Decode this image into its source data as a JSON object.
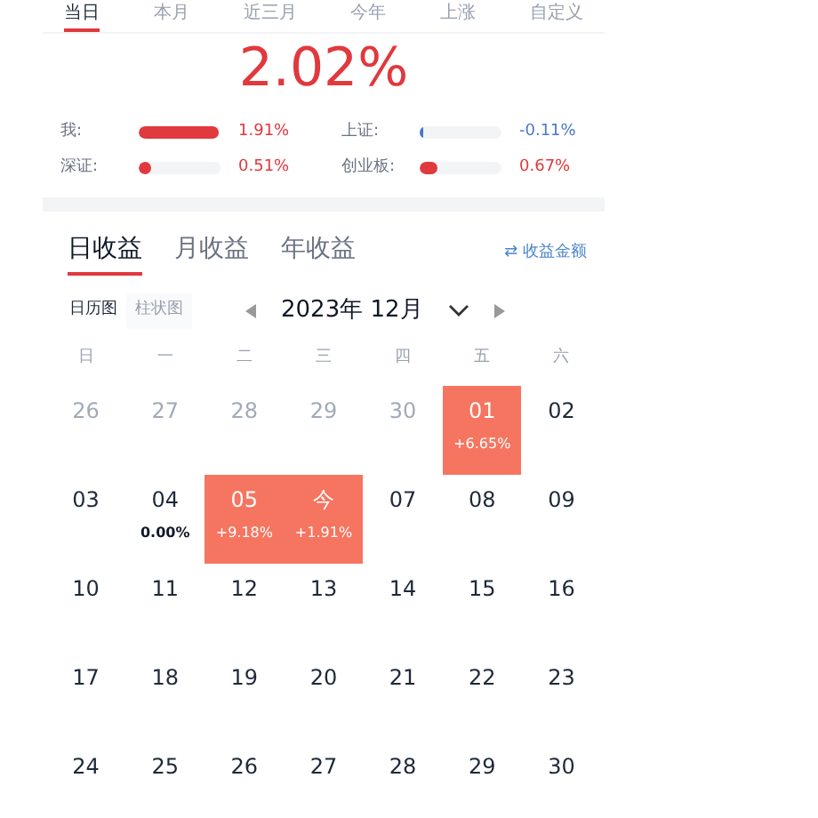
{
  "period_tabs": [
    {
      "label": "当日",
      "selected": true
    },
    {
      "label": "本月",
      "selected": false
    },
    {
      "label": "近三月",
      "selected": false
    },
    {
      "label": "今年",
      "selected": false
    },
    {
      "label": "上涨",
      "selected": false
    },
    {
      "label": "自定义",
      "selected": false
    }
  ],
  "total_return": "2.02%",
  "stats": [
    {
      "label": "我:",
      "level": 0.97,
      "color": "#e0393e",
      "value": "1.91%"
    },
    {
      "label": "上证:",
      "level": 0.02,
      "color": "#4a78c8",
      "value": "-0.11%"
    },
    {
      "label": "深证:",
      "level": 0.15,
      "color": "#e0393e",
      "value": "0.51%"
    },
    {
      "label": "创业板:",
      "level": 0.22,
      "color": "#e0393e",
      "value": "0.67%"
    }
  ],
  "return_tabs": [
    {
      "label": "日收益",
      "selected": true
    },
    {
      "label": "月收益",
      "selected": false
    },
    {
      "label": "年收益",
      "selected": false
    }
  ],
  "toggle_link": "⇄ 收益金额",
  "view_tabs": [
    {
      "label": "日历图",
      "selected": true
    },
    {
      "label": "柱状图",
      "selected": false
    }
  ],
  "month": "2023年 12月",
  "weekdays": [
    "日",
    "一",
    "二",
    "三",
    "四",
    "五",
    "六"
  ],
  "weeks": [
    [
      {
        "day": "26",
        "muted": true,
        "highlighted": false
      },
      {
        "day": "27",
        "muted": true,
        "highlighted": false
      },
      {
        "day": "28",
        "muted": true,
        "highlighted": false
      },
      {
        "day": "29",
        "muted": true,
        "highlighted": false
      },
      {
        "day": "30",
        "muted": true,
        "highlighted": false
      },
      {
        "day": "01",
        "muted": false,
        "highlighted": true,
        "value": "+6.65%"
      },
      {
        "day": "02",
        "muted": false,
        "highlighted": false
      }
    ],
    [
      {
        "day": "03",
        "muted": false,
        "highlighted": false
      },
      {
        "day": "04",
        "muted": false,
        "highlighted": false,
        "value": "0.00%"
      },
      {
        "day": "05",
        "muted": false,
        "highlighted": true,
        "value": "+9.18%"
      },
      {
        "day": "今",
        "muted": false,
        "highlighted": true,
        "value": "+1.91%"
      },
      {
        "day": "07",
        "muted": false,
        "highlighted": false
      },
      {
        "day": "08",
        "muted": false,
        "highlighted": false
      },
      {
        "day": "09",
        "muted": false,
        "highlighted": false
      }
    ],
    [
      {
        "day": "10",
        "muted": false,
        "highlighted": false
      },
      {
        "day": "11",
        "muted": false,
        "highlighted": false
      },
      {
        "day": "12",
        "muted": false,
        "highlighted": false
      },
      {
        "day": "13",
        "muted": false,
        "highlighted": false
      },
      {
        "day": "14",
        "muted": false,
        "highlighted": false
      },
      {
        "day": "15",
        "muted": false,
        "highlighted": false
      },
      {
        "day": "16",
        "muted": false,
        "highlighted": false
      }
    ],
    [
      {
        "day": "17",
        "muted": false,
        "highlighted": false
      },
      {
        "day": "18",
        "muted": false,
        "highlighted": false
      },
      {
        "day": "19",
        "muted": false,
        "highlighted": false
      },
      {
        "day": "20",
        "muted": false,
        "highlighted": false
      },
      {
        "day": "21",
        "muted": false,
        "highlighted": false
      },
      {
        "day": "22",
        "muted": false,
        "highlighted": false
      },
      {
        "day": "23",
        "muted": false,
        "highlighted": false
      }
    ],
    [
      {
        "day": "24",
        "muted": false,
        "highlighted": false
      },
      {
        "day": "25",
        "muted": false,
        "highlighted": false
      },
      {
        "day": "26",
        "muted": false,
        "highlighted": false
      },
      {
        "day": "27",
        "muted": false,
        "highlighted": false
      },
      {
        "day": "28",
        "muted": false,
        "highlighted": false
      },
      {
        "day": "29",
        "muted": false,
        "highlighted": false
      },
      {
        "day": "30",
        "muted": false,
        "highlighted": false
      }
    ]
  ]
}
